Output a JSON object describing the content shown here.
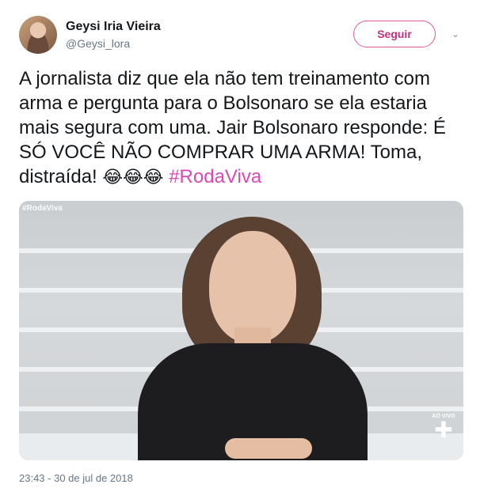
{
  "author": {
    "name": "Geysi Iria Vieira",
    "handle": "@Geysi_lora"
  },
  "follow_button": {
    "label": "Seguir"
  },
  "menu": {
    "icon": "chevron-down-icon"
  },
  "tweet": {
    "text": "A jornalista diz que ela não tem treinamento com arma e pergunta para o Bolsonaro se ela estaria mais segura com uma. Jair Bolsonaro responde: É SÓ VOCÊ NÃO COMPRAR UMA ARMA! Toma, distraída! ",
    "emojis": "😂😂😂",
    "hashtag": "#RodaViva"
  },
  "media": {
    "tag": "#RodaViva",
    "live_label": "AO VIVO"
  },
  "timestamp": "23:43 - 30 de jul de 2018",
  "colors": {
    "accent": "#c2317c",
    "hashtag": "#d849b8",
    "muted": "#657786",
    "text": "#14171a"
  }
}
